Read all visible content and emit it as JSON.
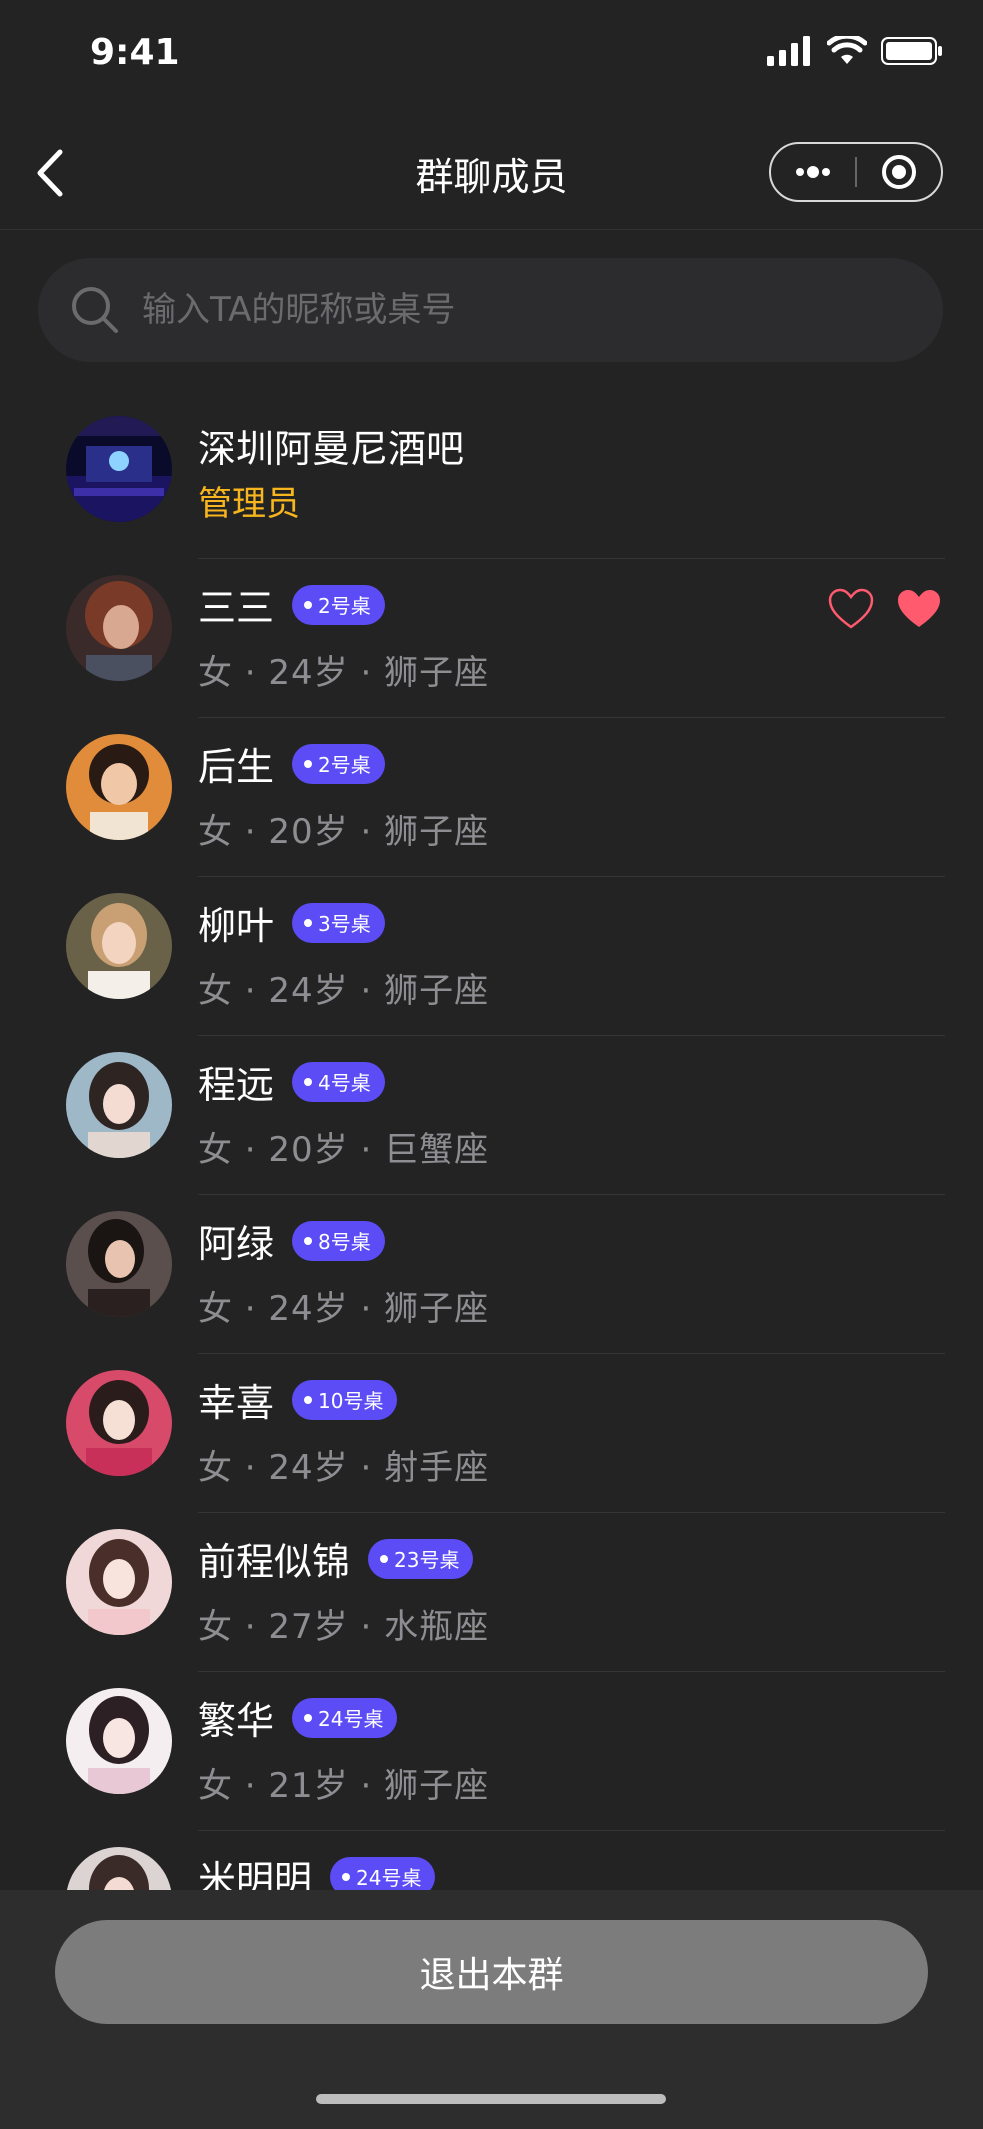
{
  "status_bar": {
    "time": "9:41"
  },
  "nav": {
    "title": "群聊成员"
  },
  "search": {
    "placeholder": "输入TA的昵称或桌号"
  },
  "admin": {
    "name": "深圳阿曼尼酒吧",
    "role": "管理员"
  },
  "members": [
    {
      "name": "三三",
      "table": "2号桌",
      "info": "女 · 24岁 · 狮子座"
    },
    {
      "name": "后生",
      "table": "2号桌",
      "info": "女 · 20岁 · 狮子座"
    },
    {
      "name": "柳叶",
      "table": "3号桌",
      "info": "女 · 24岁 · 狮子座"
    },
    {
      "name": "程远",
      "table": "4号桌",
      "info": "女 · 20岁 · 巨蟹座"
    },
    {
      "name": "阿绿",
      "table": "8号桌",
      "info": "女 · 24岁 · 狮子座"
    },
    {
      "name": "幸喜",
      "table": "10号桌",
      "info": "女 · 24岁 · 射手座"
    },
    {
      "name": "前程似锦",
      "table": "23号桌",
      "info": "女 · 27岁 · 水瓶座"
    },
    {
      "name": "繁华",
      "table": "24号桌",
      "info": "女 · 21岁 · 狮子座"
    },
    {
      "name": "米明明",
      "table": "24号桌",
      "info": ""
    }
  ],
  "bottom": {
    "exit_label": "退出本群"
  },
  "colors": {
    "background": "#232324",
    "badge": "#5b4cf5",
    "admin_label": "#f7b51e",
    "heart": "#ff5a6e",
    "exit_button": "#7c7c7d"
  }
}
